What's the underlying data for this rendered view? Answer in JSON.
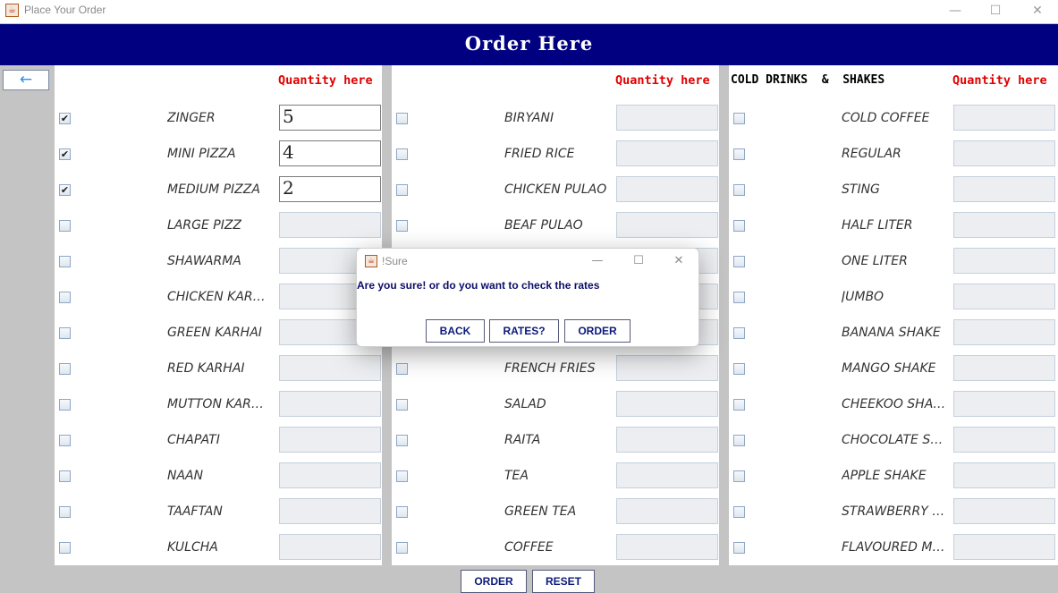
{
  "window": {
    "title": "Place Your Order",
    "minimize_glyph": "—",
    "maximize_glyph": "☐",
    "close_glyph": "✕",
    "app_icon": "java-cup-icon"
  },
  "header": {
    "title": "Order Here"
  },
  "back_button": {
    "glyph": "←"
  },
  "columns": [
    {
      "section_title": "",
      "quantity_header": "Quantity here",
      "items": [
        {
          "name": "ZINGER",
          "checked": true,
          "qty": "5"
        },
        {
          "name": "MINI PIZZA",
          "checked": true,
          "qty": "4"
        },
        {
          "name": "MEDIUM PIZZA",
          "checked": true,
          "qty": "2"
        },
        {
          "name": "LARGE PIZZ",
          "checked": false,
          "qty": ""
        },
        {
          "name": "SHAWARMA",
          "checked": false,
          "qty": ""
        },
        {
          "name": "CHICKEN KARH...",
          "checked": false,
          "qty": ""
        },
        {
          "name": "GREEN KARHAI",
          "checked": false,
          "qty": ""
        },
        {
          "name": "RED KARHAI",
          "checked": false,
          "qty": ""
        },
        {
          "name": "MUTTON KARH...",
          "checked": false,
          "qty": ""
        },
        {
          "name": "CHAPATI",
          "checked": false,
          "qty": ""
        },
        {
          "name": "NAAN",
          "checked": false,
          "qty": ""
        },
        {
          "name": "TAAFTAN",
          "checked": false,
          "qty": ""
        },
        {
          "name": "KULCHA",
          "checked": false,
          "qty": ""
        }
      ]
    },
    {
      "section_title": "",
      "quantity_header": "Quantity here",
      "items": [
        {
          "name": "BIRYANI",
          "checked": false,
          "qty": ""
        },
        {
          "name": "FRIED RICE",
          "checked": false,
          "qty": ""
        },
        {
          "name": "CHICKEN PULAO",
          "checked": false,
          "qty": ""
        },
        {
          "name": "BEAF PULAO",
          "checked": false,
          "qty": ""
        },
        {
          "name": "",
          "checked": false,
          "qty": ""
        },
        {
          "name": "",
          "checked": false,
          "qty": ""
        },
        {
          "name": "",
          "checked": false,
          "qty": ""
        },
        {
          "name": "FRENCH FRIES",
          "checked": false,
          "qty": ""
        },
        {
          "name": "SALAD",
          "checked": false,
          "qty": ""
        },
        {
          "name": "RAITA",
          "checked": false,
          "qty": ""
        },
        {
          "name": "TEA",
          "checked": false,
          "qty": ""
        },
        {
          "name": "GREEN TEA",
          "checked": false,
          "qty": ""
        },
        {
          "name": "COFFEE",
          "checked": false,
          "qty": ""
        }
      ]
    },
    {
      "section_title": "COLD DRINKS  &  SHAKES",
      "quantity_header": "Quantity here",
      "items": [
        {
          "name": "COLD COFFEE",
          "checked": false,
          "qty": ""
        },
        {
          "name": "REGULAR",
          "checked": false,
          "qty": ""
        },
        {
          "name": "STING",
          "checked": false,
          "qty": ""
        },
        {
          "name": "HALF LITER",
          "checked": false,
          "qty": ""
        },
        {
          "name": "ONE LITER",
          "checked": false,
          "qty": ""
        },
        {
          "name": "JUMBO",
          "checked": false,
          "qty": ""
        },
        {
          "name": "BANANA SHAKE",
          "checked": false,
          "qty": ""
        },
        {
          "name": "MANGO SHAKE",
          "checked": false,
          "qty": ""
        },
        {
          "name": "CHEEKOO SHAKE",
          "checked": false,
          "qty": ""
        },
        {
          "name": "CHOCOLATE SH...",
          "checked": false,
          "qty": ""
        },
        {
          "name": "APPLE SHAKE",
          "checked": false,
          "qty": ""
        },
        {
          "name": "STRAWBERRY S...",
          "checked": false,
          "qty": ""
        },
        {
          "name": "FLAVOURED MILK",
          "checked": false,
          "qty": ""
        }
      ]
    }
  ],
  "dialog": {
    "title": "!Sure",
    "message": "Are you sure! or do you want to check the rates",
    "back_label": "BACK",
    "rates_label": "RATES?",
    "order_label": "ORDER"
  },
  "footer": {
    "order_label": "ORDER",
    "reset_label": "RESET"
  }
}
